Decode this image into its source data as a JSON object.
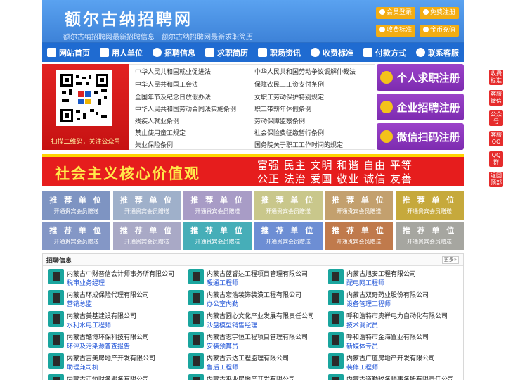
{
  "header": {
    "title": "额尔古纳招聘网",
    "subtitle": "额尔古纳招聘网最新招聘信息　额尔古纳招聘网最新求职简历",
    "buttons": [
      "会员登录",
      "免费注册",
      "收费标准",
      "金币充值"
    ],
    "colors": {
      "header_bg": "#4a90e2",
      "button_bg": "#f3ad13"
    }
  },
  "nav": {
    "items": [
      {
        "label": "网站首页",
        "icon": "home-icon"
      },
      {
        "label": "用人单位",
        "icon": "building-icon"
      },
      {
        "label": "招聘信息",
        "icon": "bullhorn-icon"
      },
      {
        "label": "求职简历",
        "icon": "resume-icon"
      },
      {
        "label": "职场资讯",
        "icon": "news-icon"
      },
      {
        "label": "收费标准",
        "icon": "coin-icon"
      },
      {
        "label": "付款方式",
        "icon": "card-icon"
      },
      {
        "label": "联系客服",
        "icon": "phone-icon"
      }
    ]
  },
  "qr": {
    "caption": "扫描二维码，关注公众号"
  },
  "laws": [
    "中华人民共和国就业促进法",
    "中华人民共和国劳动争议调解仲裁法",
    "中华人民共和国工会法",
    "保障农民工工资支付条例",
    "全国年节及纪念日放假办法",
    "女职工劳动保护特别规定",
    "中华人民共和国劳动合同法实施条例",
    "职工带薪年休假条例",
    "残疾人就业条例",
    "劳动保障监察条例",
    "禁止使用童工规定",
    "社会保险费征缴暂行条例",
    "失业保险条例",
    "国务院关于职工工作时间的规定"
  ],
  "register": [
    "个人求职注册",
    "企业招聘注册",
    "微信扫码注册"
  ],
  "banner": {
    "main": "社会主义核心价值观",
    "line1": "富强 民主 文明 和谐 自由 平等",
    "line2": "公正 法治 爱国 敬业 诚信 友善"
  },
  "ads": {
    "title": "推 荐 单 位",
    "subtitle": "开通贵宾会员赠送",
    "colors": [
      "#7e94c2",
      "#9fb0ca",
      "#a89cc6",
      "#c9c78b",
      "#c3a06e",
      "#c6a93c",
      "#8497c6",
      "#a9a9c6",
      "#46aeb8",
      "#6d8ed4",
      "#c07a4c",
      "#a6a6a0"
    ]
  },
  "jobs": {
    "title": "招聘信息",
    "more": "更多»",
    "items": [
      {
        "company": "内蒙古中财普信会计师事务所有限公司",
        "position": "税审业务经理"
      },
      {
        "company": "内蒙古蓝睿达工程项目管理有限公司",
        "position": "暖通工程师"
      },
      {
        "company": "内蒙古旭安工程有限公司",
        "position": "配电网工程师"
      },
      {
        "company": "内蒙古环成保险代理有限公司",
        "position": "营销总监"
      },
      {
        "company": "内蒙古宏浩装饰装潢工程有限公司",
        "position": "办公室内勤"
      },
      {
        "company": "内蒙古双奇药业股份有限公司",
        "position": "设备管理工程师"
      },
      {
        "company": "内蒙古美基建设有限公司",
        "position": "水利水电工程师"
      },
      {
        "company": "内蒙古圆心文化产业发展有限责任公司",
        "position": "沙盘模型销售经理"
      },
      {
        "company": "呼和浩特市奥祥电力自动化有限公司",
        "position": "技术调试员"
      },
      {
        "company": "内蒙古酷博环保科技有限公司",
        "position": "环评及污染源普查报告"
      },
      {
        "company": "内蒙古志宇恒工程项目管理有限公司",
        "position": "安装预算员"
      },
      {
        "company": "呼和浩特市金海置业有限公司",
        "position": "新媒体专员"
      },
      {
        "company": "内蒙古吉美房地产开发有限公司",
        "position": "助理兼司机"
      },
      {
        "company": "内蒙古云达工程监理有限公司",
        "position": "售后工程师"
      },
      {
        "company": "内蒙古广厦房地产开发有限公司",
        "position": "装修工程师"
      },
      {
        "company": "内蒙古正恒财务服务有限公司",
        "position": "电话邀约人员"
      },
      {
        "company": "内蒙古平业房地产开发有限公司",
        "position": "物业工程经理"
      },
      {
        "company": "内蒙古道勤税务师事务所有限责任公司",
        "position": "税务代理申报"
      }
    ]
  },
  "float": [
    "收费标准",
    "客服微信",
    "公众号",
    "客服QQ号",
    "QQ群",
    "返回顶部"
  ]
}
